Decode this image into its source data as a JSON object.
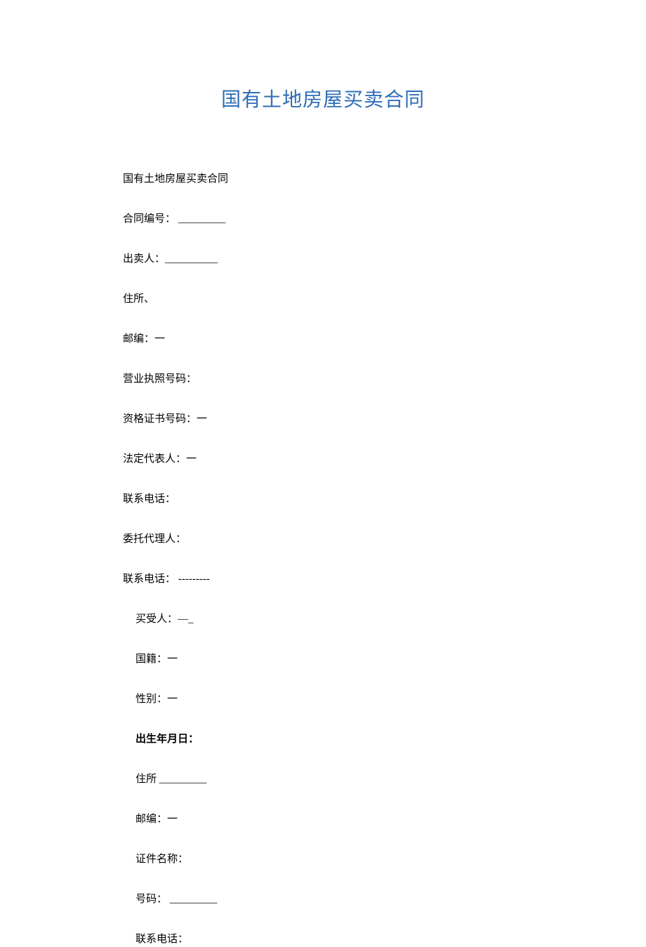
{
  "title": "国有土地房屋买卖合同",
  "fields": [
    {
      "text": "国有土地房屋买卖合同",
      "indented": false,
      "bold": false
    },
    {
      "text": "合同编号： _________",
      "indented": false,
      "bold": false
    },
    {
      "text": "出卖人：__________",
      "indented": false,
      "bold": false,
      "smallBlank": true
    },
    {
      "text": "住所、",
      "indented": false,
      "bold": false
    },
    {
      "text": "邮编：一",
      "indented": false,
      "bold": false
    },
    {
      "text": "营业执照号码：",
      "indented": false,
      "bold": false
    },
    {
      "text": "资格证书号码：一",
      "indented": false,
      "bold": false
    },
    {
      "text": "法定代表人：一",
      "indented": false,
      "bold": false
    },
    {
      "text": "联系电话：",
      "indented": false,
      "bold": false
    },
    {
      "text": "委托代理人：",
      "indented": false,
      "bold": false
    },
    {
      "text": "联系电话： ---------",
      "indented": false,
      "bold": false
    },
    {
      "text": "买受人：—_",
      "indented": true,
      "bold": false
    },
    {
      "text": "国籍：一",
      "indented": true,
      "bold": false
    },
    {
      "text": "性别：一",
      "indented": true,
      "bold": false
    },
    {
      "text": "出生年月日：",
      "indented": true,
      "bold": true
    },
    {
      "text": "住所 _________",
      "indented": true,
      "bold": false
    },
    {
      "text": "邮编：一",
      "indented": true,
      "bold": false
    },
    {
      "text": "证件名称：",
      "indented": true,
      "bold": false
    },
    {
      "text": "号码： _________",
      "indented": true,
      "bold": false
    },
    {
      "text": "联系电话：",
      "indented": true,
      "bold": false
    }
  ]
}
